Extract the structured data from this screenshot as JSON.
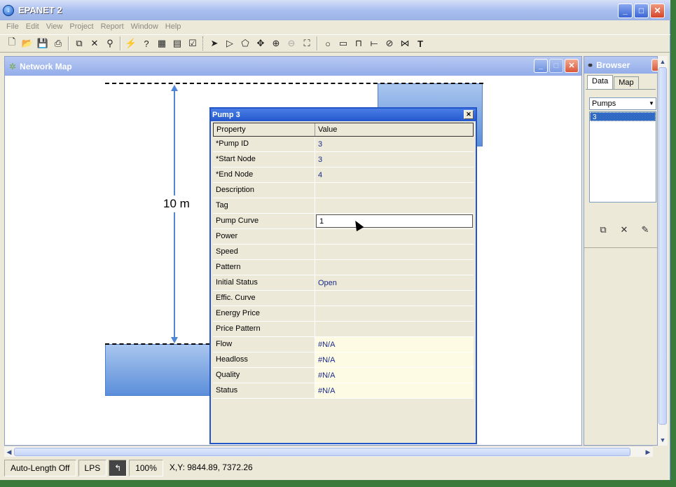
{
  "app": {
    "title": "EPANET 2"
  },
  "menu": [
    "File",
    "Edit",
    "View",
    "Project",
    "Report",
    "Window",
    "Help"
  ],
  "toolbar_icons": [
    "new-file-icon",
    "open-folder-icon",
    "save-icon",
    "print-icon",
    "copy-icon",
    "delete-icon",
    "find-icon",
    "run-icon",
    "query-icon",
    "graph-icon",
    "table-icon",
    "options-icon",
    "select-object-icon",
    "select-vertex-icon",
    "select-region-icon",
    "pan-icon",
    "zoom-in-icon",
    "zoom-out-icon",
    "full-extent-icon",
    "add-junction-icon",
    "add-reservoir-icon",
    "add-tank-icon",
    "add-pipe-icon",
    "add-pump-icon",
    "add-valve-icon",
    "add-label-icon"
  ],
  "network_map": {
    "title": "Network Map",
    "dimension_label": "10 m"
  },
  "browser": {
    "title": "Browser",
    "tabs": [
      "Data",
      "Map"
    ],
    "category": "Pumps",
    "selected_item": "3"
  },
  "dialog": {
    "title": "Pump 3",
    "header": {
      "property": "Property",
      "value": "Value"
    },
    "rows": [
      {
        "property": "*Pump ID",
        "value": "3",
        "readonly": false
      },
      {
        "property": "*Start Node",
        "value": "3",
        "readonly": false
      },
      {
        "property": "*End Node",
        "value": "4",
        "readonly": false
      },
      {
        "property": "Description",
        "value": "",
        "readonly": false
      },
      {
        "property": "Tag",
        "value": "",
        "readonly": false
      },
      {
        "property": "Pump Curve",
        "value": "1",
        "readonly": false,
        "editing": true
      },
      {
        "property": "Power",
        "value": "",
        "readonly": false
      },
      {
        "property": "Speed",
        "value": "",
        "readonly": false
      },
      {
        "property": "Pattern",
        "value": "",
        "readonly": false
      },
      {
        "property": "Initial Status",
        "value": "Open",
        "readonly": false
      },
      {
        "property": "Effic. Curve",
        "value": "",
        "readonly": false
      },
      {
        "property": "Energy Price",
        "value": "",
        "readonly": false
      },
      {
        "property": "Price Pattern",
        "value": "",
        "readonly": false
      },
      {
        "property": "Flow",
        "value": "#N/A",
        "readonly": true
      },
      {
        "property": "Headloss",
        "value": "#N/A",
        "readonly": true
      },
      {
        "property": "Quality",
        "value": "#N/A",
        "readonly": true
      },
      {
        "property": "Status",
        "value": "#N/A",
        "readonly": true
      }
    ]
  },
  "status_bar": {
    "auto_length": "Auto-Length Off",
    "flow_units": "LPS",
    "zoom": "100%",
    "coords": "X,Y: 9844.89, 7372.26"
  }
}
